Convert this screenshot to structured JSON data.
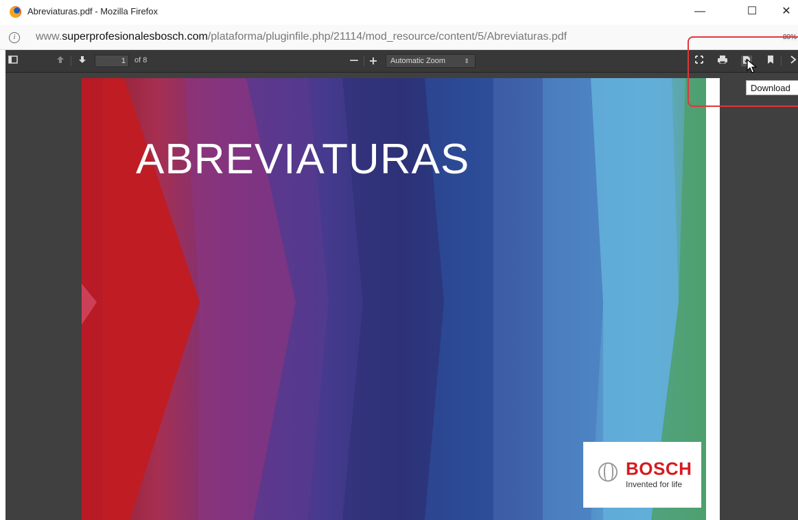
{
  "window": {
    "title": "Abreviaturas.pdf - Mozilla Firefox",
    "minimize": "—",
    "maximize": "☐",
    "close": "✕"
  },
  "urlbar": {
    "url_prefix": "www.",
    "url_domain": "superprofesionalesbosch.com",
    "url_path": "/plataforma/pluginfile.php/21114/mod_resource/content/5/Abreviaturas.pdf",
    "zoom_level": "80%"
  },
  "pdf_toolbar": {
    "page_number": "1",
    "page_count": "of 8",
    "zoom_out": "—",
    "zoom_in": "+",
    "zoom_select": "Automatic Zoom",
    "zoom_arrow": "⇕"
  },
  "icons": {
    "sidebar": "sidebar-toggle-icon",
    "prev": "previous-page-icon",
    "next": "next-page-icon",
    "presentation": "presentation-mode-icon",
    "print": "print-icon",
    "download": "download-icon",
    "bookmark": "bookmark-icon",
    "tools": "tools-icon"
  },
  "document": {
    "cover_title": "ABREVIATURAS",
    "brand_name": "BOSCH",
    "brand_tagline": "Invented for life"
  },
  "tooltip": {
    "text": "Download"
  },
  "colors": {
    "toolbar_bg": "#383838",
    "viewer_bg": "#404040",
    "highlight": "#e0353a",
    "brand_red": "#d7191f"
  }
}
